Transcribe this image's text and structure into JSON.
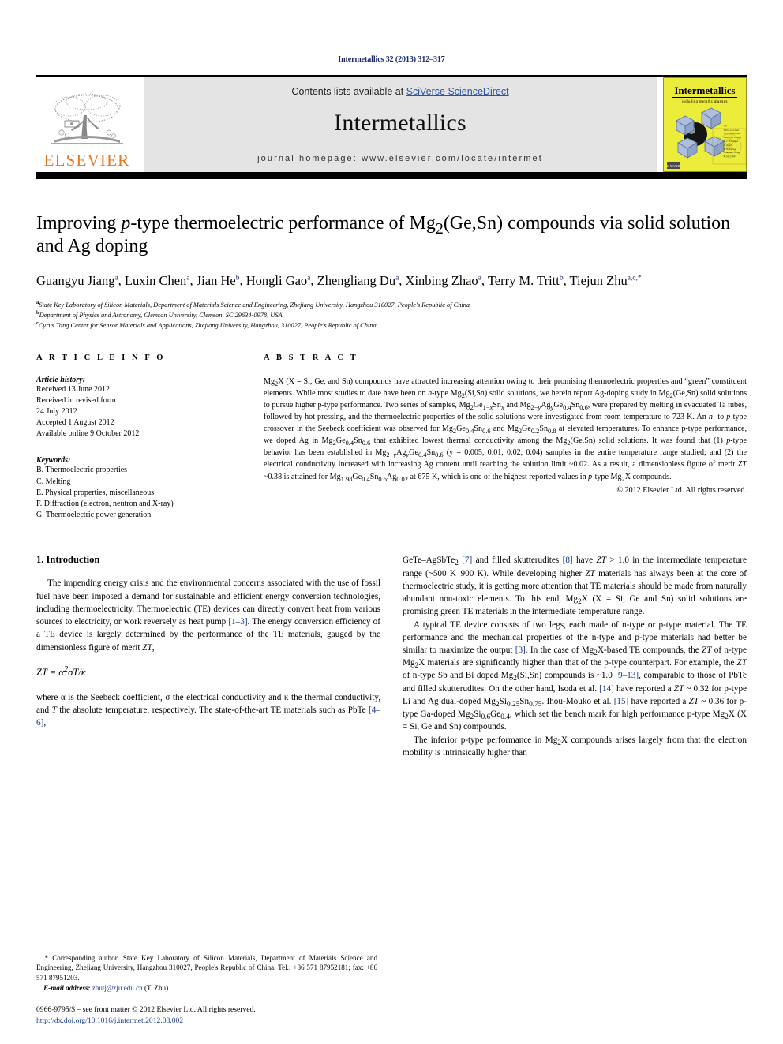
{
  "running_head": "Intermetallics 32 (2013) 312–317",
  "masthead": {
    "publisher_name": "ELSEVIER",
    "contents_prefix": "Contents lists available at ",
    "contents_link": "SciVerse ScienceDirect",
    "journal_name": "Intermetallics",
    "homepage": "journal homepage: www.elsevier.com/locate/intermet",
    "cover_title": "Intermetallics",
    "cover_subtitle": "including metallic glasses"
  },
  "article": {
    "title_line1_a": "Improving ",
    "title_p": "p",
    "title_line1_b": "-type thermoelectric performance of Mg",
    "title_sub2": "2",
    "title_line1_c": "(Ge,Sn) compounds via solid",
    "title_line2": "solution and Ag doping",
    "authors": [
      {
        "name": "Guangyu Jiang",
        "sup": "a",
        "sep": ", "
      },
      {
        "name": "Luxin Chen",
        "sup": "a",
        "sep": ", "
      },
      {
        "name": "Jian He",
        "sup": "b",
        "sep": ", "
      },
      {
        "name": "Hongli Gao",
        "sup": "a",
        "sep": ", "
      },
      {
        "name": "Zhengliang Du",
        "sup": "a",
        "sep": ", "
      },
      {
        "name": "Xinbing Zhao",
        "sup": "a",
        "sep": ", "
      },
      {
        "name": "Terry M. Tritt",
        "sup": "b",
        "sep": ", "
      },
      {
        "name": "Tiejun Zhu",
        "sup": "a,c,*",
        "sep": ""
      }
    ],
    "affiliations": [
      {
        "mark": "a",
        "text": "State Key Laboratory of Silicon Materials, Department of Materials Science and Engineering, Zhejiang University, Hangzhou 310027, People's Republic of China"
      },
      {
        "mark": "b",
        "text": "Department of Physics and Astronomy, Clemson University, Clemson, SC 29634-0978, USA"
      },
      {
        "mark": "c",
        "text": "Cyrus Tang Center for Sensor Materials and Applications, Zhejiang University, Hangzhou, 310027, People's Republic of China"
      }
    ]
  },
  "info": {
    "heading": "A R T I C L E   I N F O",
    "history_title": "Article history:",
    "history": [
      "Received 13 June 2012",
      "Received in revised form",
      "24 July 2012",
      "Accepted 1 August 2012",
      "Available online 9 October 2012"
    ],
    "keywords_title": "Keywords:",
    "keywords": [
      "B. Thermoelectric properties",
      "C. Melting",
      "E. Physical properties, miscellaneous",
      "F. Diffraction (electron, neutron and X-ray)",
      "G. Thermoelectric power generation"
    ]
  },
  "abstract": {
    "heading": "A B S T R A C T",
    "copyright": "© 2012 Elsevier Ltd. All rights reserved."
  },
  "intro": {
    "heading": "1. Introduction",
    "equation": "ZT = α²σT/κ"
  },
  "footnotes": {
    "email_label": "E-mail address:",
    "email": "zhutj@zju.edu.cn",
    "email_suffix": " (T. Zhu).",
    "issn_line": "0966-9795/$ – see front matter © 2012 Elsevier Ltd. All rights reserved.",
    "doi": "http://dx.doi.org/10.1016/j.intermet.2012.08.002"
  },
  "colors": {
    "elsevier_orange": "#E87722",
    "link_blue": "#2b53a6",
    "ref_blue": "#1a3a8f",
    "cover_yellow": "#ecec3a",
    "masthead_gray": "#e4e4e4"
  }
}
